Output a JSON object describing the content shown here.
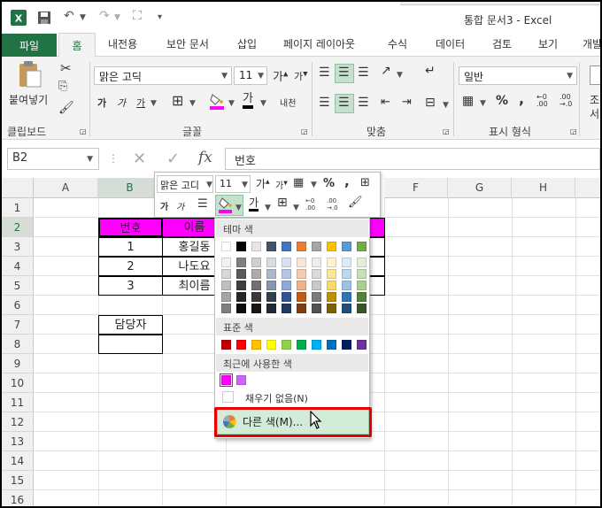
{
  "title_bar": {
    "title": "통합 문서3 - Excel",
    "app_icon": "excel-icon"
  },
  "quick_access": [
    "save-icon",
    "undo-icon",
    "redo-icon",
    "touch-mode-icon",
    "customize-icon"
  ],
  "tabs": {
    "file": "파일",
    "items": [
      "홈",
      "내전용",
      "보안 문서",
      "삽입",
      "페이지 레이아웃",
      "수식",
      "데이터",
      "검토",
      "보기",
      "개발"
    ]
  },
  "ribbon": {
    "clipboard": {
      "paste": "붙여넣기",
      "group": "클립보드"
    },
    "font": {
      "name": "맑은 고딕",
      "size": "11",
      "bold": "가",
      "italic": "가",
      "underline": "가",
      "phonetic": "내천",
      "group": "글꼴"
    },
    "align": {
      "group": "맞춤"
    },
    "number": {
      "format": "일반",
      "percent": "%",
      "comma": ",",
      "group": "표시 형식"
    },
    "styles_partial": [
      "조",
      "서"
    ]
  },
  "formula_bar": {
    "name_box": "B2",
    "fx": "fx",
    "content": "번호"
  },
  "sheet": {
    "columns": [
      "A",
      "B",
      "C",
      "D",
      "E",
      "F",
      "G",
      "H"
    ],
    "rows": [
      "1",
      "2",
      "3",
      "4",
      "5",
      "6",
      "7",
      "8",
      "9",
      "10",
      "11",
      "12",
      "13",
      "14",
      "15",
      "16"
    ],
    "headers": [
      "번호",
      "이름"
    ],
    "numbers": [
      "1",
      "2",
      "3"
    ],
    "names": [
      "홍길동",
      "나도요",
      "최이름"
    ],
    "manager_label": "담당자"
  },
  "mini_toolbar": {
    "font": "맑은 고디",
    "size": "11",
    "percent": "%",
    "comma": ",",
    "bold": "가",
    "italic": "가"
  },
  "color_menu": {
    "theme_label": "테마 색",
    "standard_label": "표준 색",
    "recent_label": "최근에 사용한 색",
    "no_fill": "채우기 없음(N)",
    "more_colors": "다른 색(M)...",
    "theme_top": [
      "#ffffff",
      "#000000",
      "#e7e6e6",
      "#44546a",
      "#4472c4",
      "#ed7d31",
      "#a5a5a5",
      "#ffc000",
      "#5b9bd5",
      "#70ad47"
    ],
    "theme_shades": [
      [
        "#f2f2f2",
        "#7f7f7f",
        "#d0cece",
        "#d6dce4",
        "#d9e2f3",
        "#fbe5d5",
        "#ededed",
        "#fff2cc",
        "#deebf6",
        "#e2efd9"
      ],
      [
        "#d8d8d8",
        "#595959",
        "#aeabab",
        "#adb9ca",
        "#b4c6e7",
        "#f7cbac",
        "#dbdbdb",
        "#fee599",
        "#bdd7ee",
        "#c5e0b3"
      ],
      [
        "#bfbfbf",
        "#3f3f3f",
        "#757070",
        "#8496b0",
        "#8eaadb",
        "#f4b183",
        "#c9c9c9",
        "#ffd965",
        "#9cc3e5",
        "#a8d08d"
      ],
      [
        "#a5a5a5",
        "#262626",
        "#3a3838",
        "#323f4f",
        "#2f5496",
        "#c55a11",
        "#7b7b7b",
        "#bf8f00",
        "#2e75b5",
        "#538135"
      ],
      [
        "#7f7f7f",
        "#0c0c0c",
        "#171616",
        "#222a35",
        "#1f3864",
        "#833c0b",
        "#525252",
        "#7f6000",
        "#1e4e79",
        "#375623"
      ]
    ],
    "standard": [
      "#c00000",
      "#ff0000",
      "#ffc000",
      "#ffff00",
      "#92d050",
      "#00b050",
      "#00b0f0",
      "#0070c0",
      "#002060",
      "#7030a0"
    ],
    "recent": [
      "#ff00ff",
      "#cc66ff"
    ]
  },
  "colors": {
    "accent": "#217346",
    "highlight": "#ff00ff",
    "callout": "#e60000"
  }
}
